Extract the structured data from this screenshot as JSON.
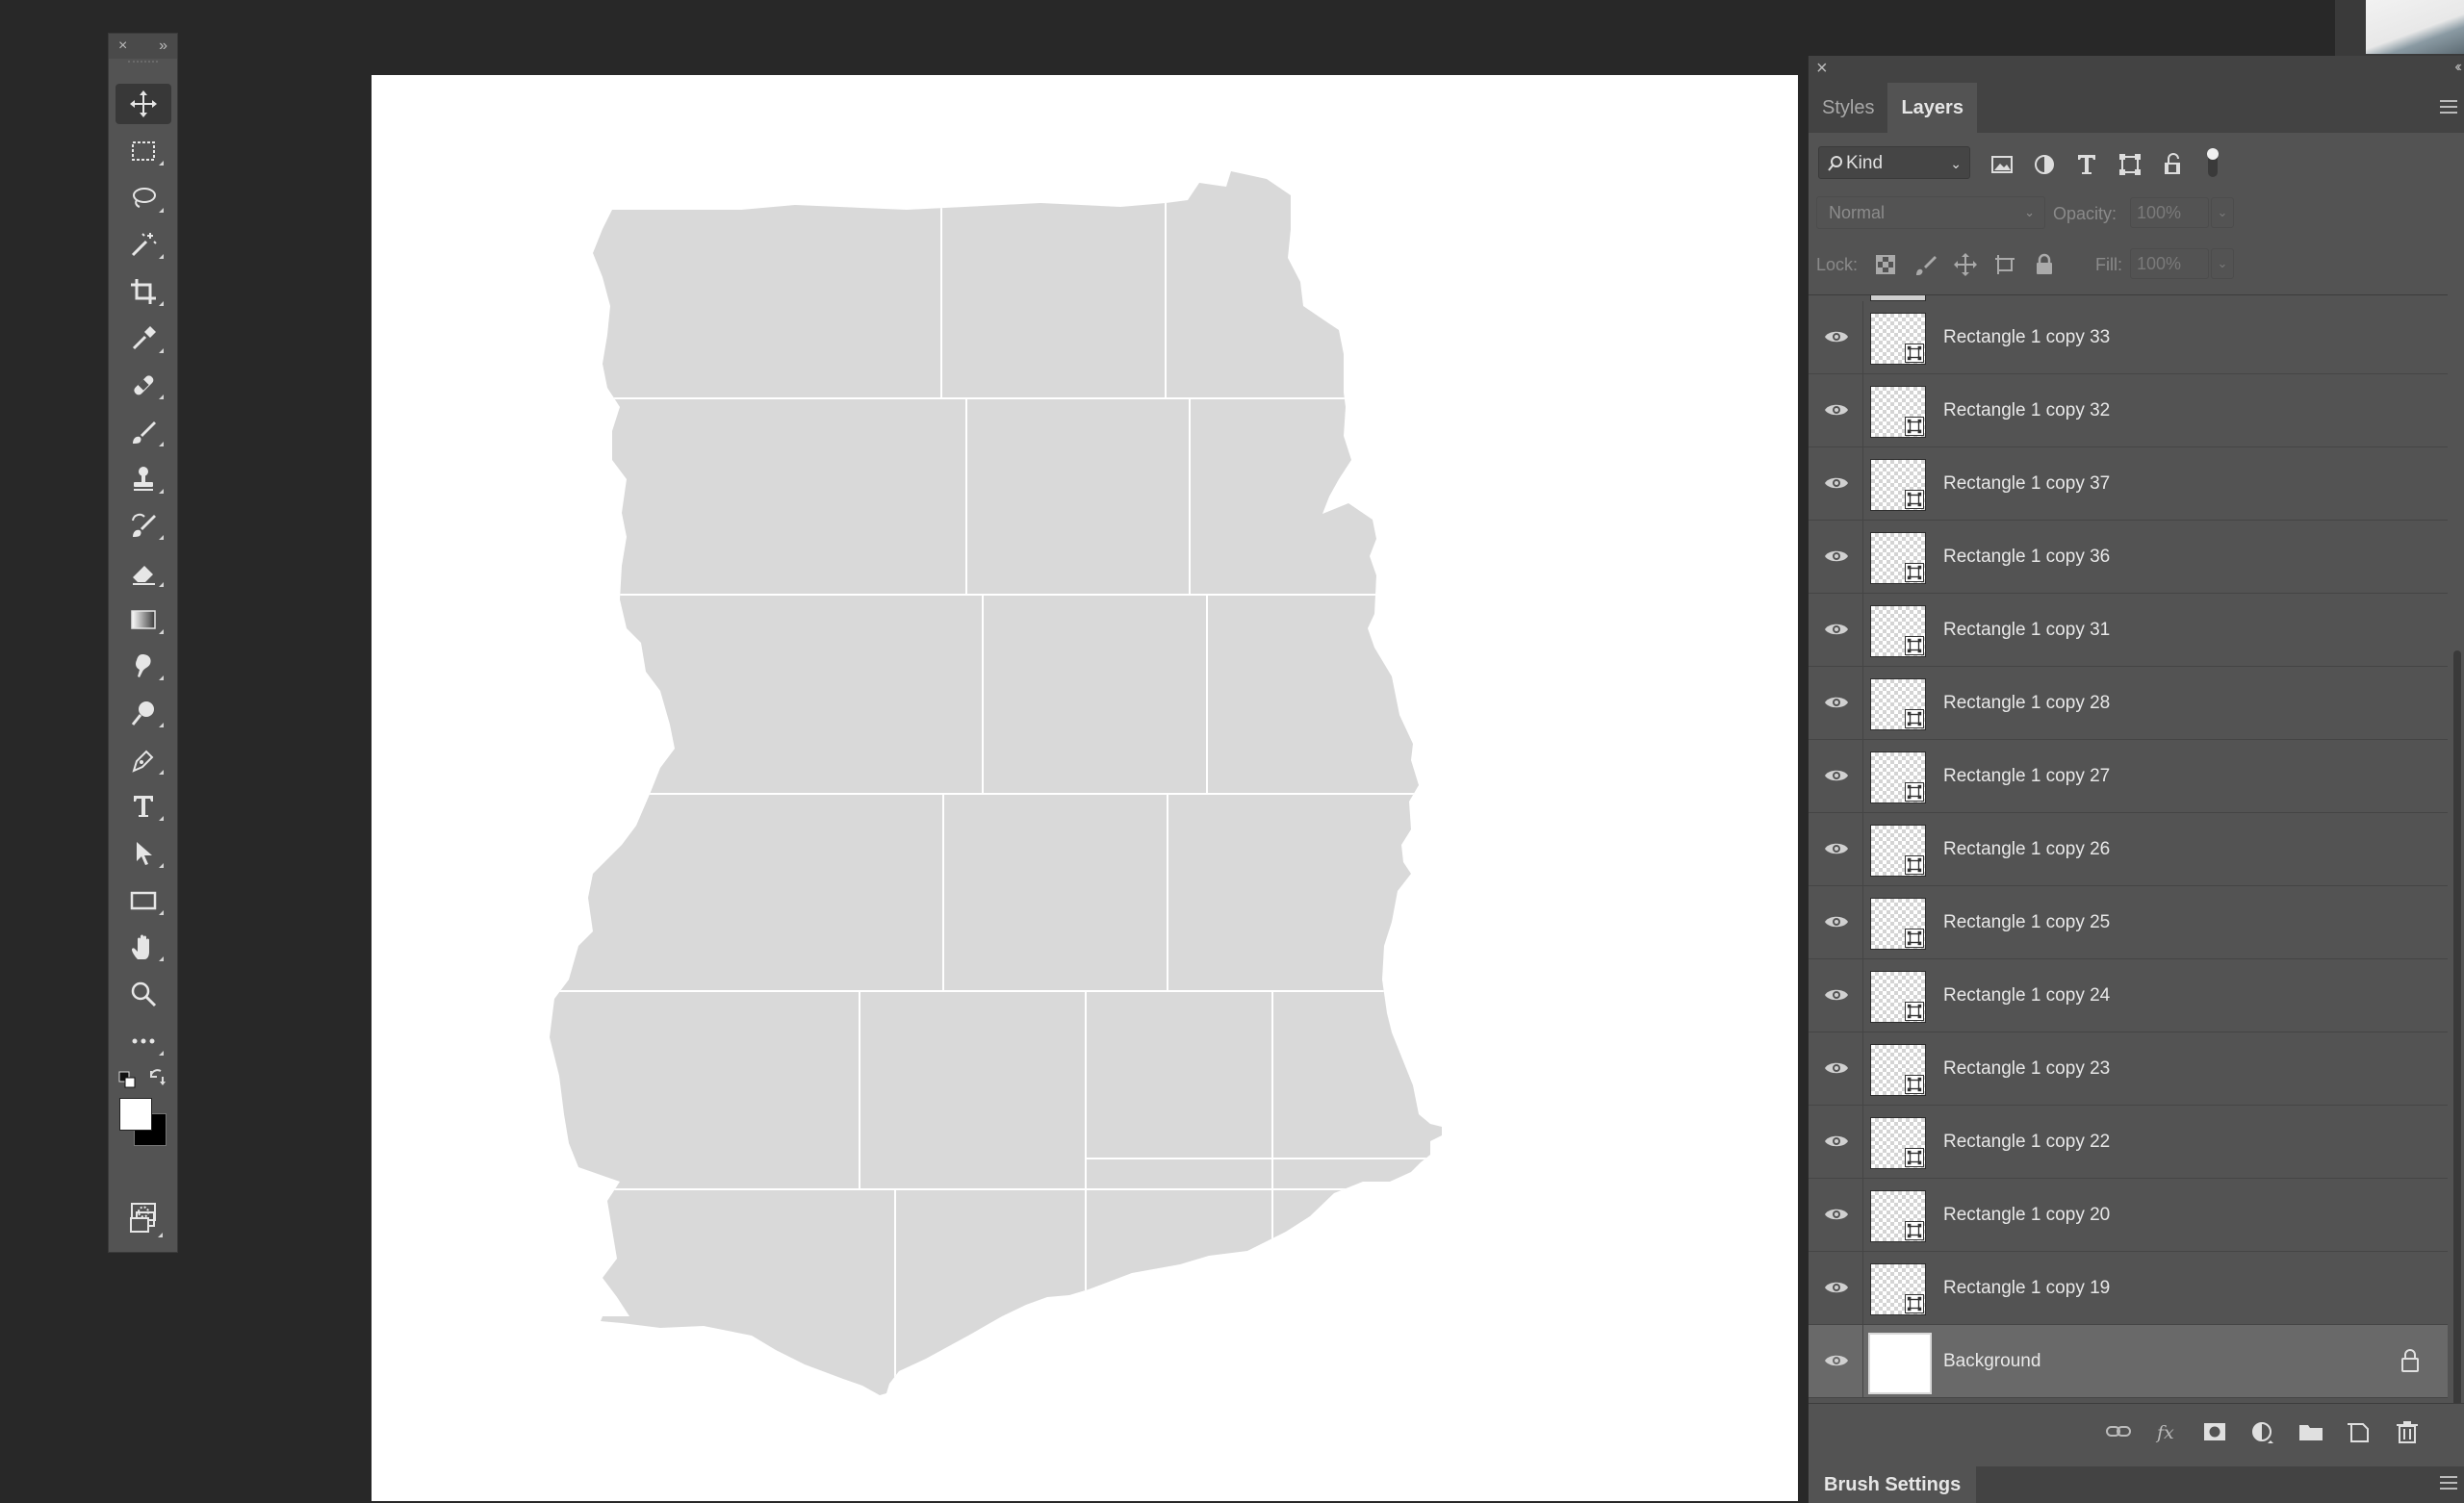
{
  "toolbar": {
    "close_glyph": "×",
    "collapse_glyph": "»",
    "tools": [
      {
        "name": "move-tool",
        "icon": "move-icon",
        "active": true
      },
      {
        "name": "marquee-tool",
        "icon": "marquee-icon"
      },
      {
        "name": "lasso-tool",
        "icon": "lasso-icon"
      },
      {
        "name": "magic-wand-tool",
        "icon": "magic-wand-icon"
      },
      {
        "name": "crop-tool",
        "icon": "crop-icon"
      },
      {
        "name": "eyedropper-tool",
        "icon": "eyedropper-icon"
      },
      {
        "name": "healing-brush-tool",
        "icon": "bandage-icon"
      },
      {
        "name": "brush-tool",
        "icon": "brush-icon"
      },
      {
        "name": "clone-stamp-tool",
        "icon": "stamp-icon"
      },
      {
        "name": "history-brush-tool",
        "icon": "history-brush-icon"
      },
      {
        "name": "eraser-tool",
        "icon": "eraser-icon"
      },
      {
        "name": "gradient-tool",
        "icon": "gradient-icon"
      },
      {
        "name": "smudge-tool",
        "icon": "smudge-icon"
      },
      {
        "name": "dodge-tool",
        "icon": "dodge-icon"
      },
      {
        "name": "pen-tool",
        "icon": "pen-icon"
      },
      {
        "name": "type-tool",
        "icon": "type-icon"
      },
      {
        "name": "path-selection-tool",
        "icon": "arrow-icon"
      },
      {
        "name": "rectangle-tool",
        "icon": "rectangle-icon"
      },
      {
        "name": "hand-tool",
        "icon": "hand-icon"
      },
      {
        "name": "zoom-tool",
        "icon": "zoom-icon"
      },
      {
        "name": "more-tools",
        "icon": "ellipsis-icon"
      }
    ],
    "foreground_color": "#ffffff",
    "background_color": "#000000"
  },
  "panel": {
    "tabs": [
      {
        "label": "Styles",
        "active": false
      },
      {
        "label": "Layers",
        "active": true
      }
    ],
    "filter": {
      "kind_label": "Kind"
    },
    "blend_mode": "Normal",
    "opacity_label": "Opacity:",
    "opacity_value": "100%",
    "lock_label": "Lock:",
    "fill_label": "Fill:",
    "fill_value": "100%",
    "layers": [
      {
        "name": "Rectangle 1 copy 33"
      },
      {
        "name": "Rectangle 1 copy 32"
      },
      {
        "name": "Rectangle 1 copy 37"
      },
      {
        "name": "Rectangle 1 copy 36"
      },
      {
        "name": "Rectangle 1 copy 31"
      },
      {
        "name": "Rectangle 1 copy 28"
      },
      {
        "name": "Rectangle 1 copy 27"
      },
      {
        "name": "Rectangle 1 copy 26"
      },
      {
        "name": "Rectangle 1 copy 25"
      },
      {
        "name": "Rectangle 1 copy 24"
      },
      {
        "name": "Rectangle 1 copy 23"
      },
      {
        "name": "Rectangle 1 copy 22"
      },
      {
        "name": "Rectangle 1 copy 20"
      },
      {
        "name": "Rectangle 1 copy 19"
      },
      {
        "name": "Background",
        "locked": true
      }
    ],
    "bottom_panel_tab": "Brush Settings"
  },
  "canvas": {
    "background": "#ffffff",
    "shape_fill": "#d9d9d9",
    "grid_line_color": "#ffffff"
  },
  "colors": {
    "app_bg": "#282828",
    "panel_bg": "#535353",
    "panel_header_bg": "#434343",
    "selected_layer_bg": "#696969"
  }
}
